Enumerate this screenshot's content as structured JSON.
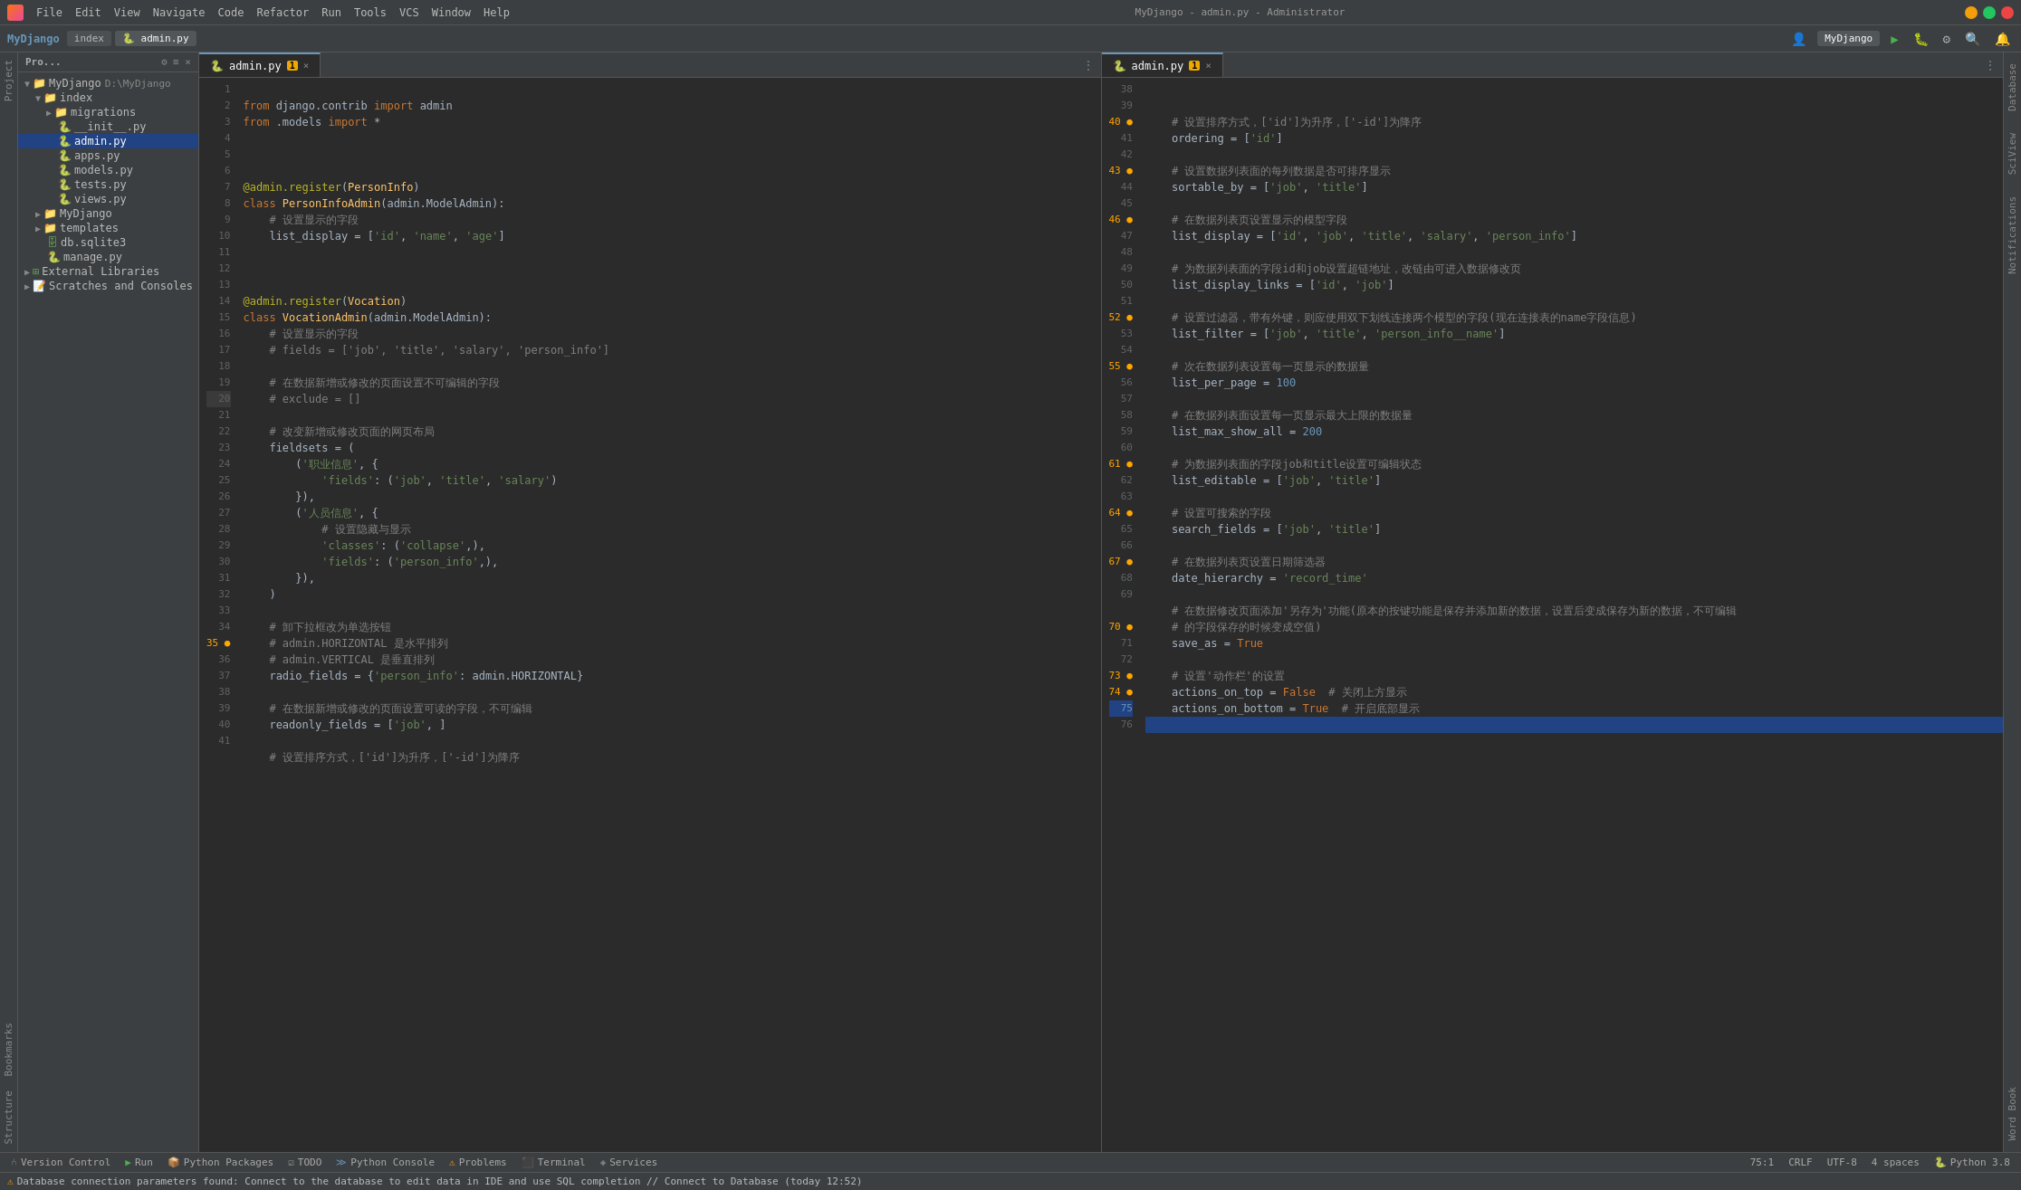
{
  "app": {
    "title": "MyDjango - admin.py - Administrator",
    "icon": "pycharm"
  },
  "menu": {
    "items": [
      "File",
      "Edit",
      "View",
      "Navigate",
      "Code",
      "Refactor",
      "Run",
      "Tools",
      "VCS",
      "Window",
      "Help"
    ]
  },
  "toolbar": {
    "project_label": "MyDjango",
    "tabs": [
      "index",
      "admin.py"
    ],
    "run_config": "MyDjango",
    "title": "MyDjango - admin.py - Administrator"
  },
  "project_panel": {
    "title": "Pro...",
    "tree": [
      {
        "id": "mydjango-root",
        "label": "MyDjango",
        "path": "D:\\MyDjango",
        "type": "root",
        "expanded": true,
        "indent": 0
      },
      {
        "id": "index",
        "label": "index",
        "type": "folder",
        "expanded": true,
        "indent": 1
      },
      {
        "id": "migrations",
        "label": "migrations",
        "type": "folder",
        "expanded": false,
        "indent": 2
      },
      {
        "id": "__init__py",
        "label": "__init__.py",
        "type": "file-py",
        "indent": 2
      },
      {
        "id": "adminpy",
        "label": "admin.py",
        "type": "file-py",
        "indent": 2,
        "selected": true
      },
      {
        "id": "appspy",
        "label": "apps.py",
        "type": "file-py",
        "indent": 2
      },
      {
        "id": "modelspy",
        "label": "models.py",
        "type": "file-py",
        "indent": 2
      },
      {
        "id": "testspy",
        "label": "tests.py",
        "type": "file-py",
        "indent": 2
      },
      {
        "id": "viewspy",
        "label": "views.py",
        "type": "file-py",
        "indent": 2
      },
      {
        "id": "mydjango",
        "label": "MyDjango",
        "type": "folder",
        "expanded": false,
        "indent": 1
      },
      {
        "id": "templates",
        "label": "templates",
        "type": "folder",
        "expanded": false,
        "indent": 1
      },
      {
        "id": "dbsqlite3",
        "label": "db.sqlite3",
        "type": "file-sqlite",
        "indent": 1
      },
      {
        "id": "managepy",
        "label": "manage.py",
        "type": "file-py",
        "indent": 1
      },
      {
        "id": "external-libs",
        "label": "External Libraries",
        "type": "folder-ext",
        "expanded": false,
        "indent": 0
      },
      {
        "id": "scratches",
        "label": "Scratches and Consoles",
        "type": "folder-scratch",
        "expanded": false,
        "indent": 0
      }
    ]
  },
  "left_editor": {
    "tab_label": "admin.py",
    "warning_count": "1",
    "lines": [
      {
        "n": 1,
        "code": "from django.contrib import admin"
      },
      {
        "n": 2,
        "code": "from .models import *"
      },
      {
        "n": 3,
        "code": ""
      },
      {
        "n": 4,
        "code": ""
      },
      {
        "n": 5,
        "code": ""
      },
      {
        "n": 6,
        "code": "@admin.register(PersonInfo)"
      },
      {
        "n": 7,
        "code": "class PersonInfoAdmin(admin.ModelAdmin):"
      },
      {
        "n": 8,
        "code": "    # 设置显示的字段"
      },
      {
        "n": 9,
        "code": "    list_display = ['id', 'name', 'age']"
      },
      {
        "n": 10,
        "code": ""
      },
      {
        "n": 11,
        "code": ""
      },
      {
        "n": 12,
        "code": ""
      },
      {
        "n": 13,
        "code": "@admin.register(Vocation)"
      },
      {
        "n": 14,
        "code": "class VocationAdmin(admin.ModelAdmin):"
      },
      {
        "n": 15,
        "code": "    # 设置显示的字段"
      },
      {
        "n": 16,
        "code": "    # fields = ['job', 'title', 'salary', 'person_info']"
      },
      {
        "n": 17,
        "code": ""
      },
      {
        "n": 18,
        "code": "    # 在数据新增或修改的页面设置不可编辑的字段"
      },
      {
        "n": 19,
        "code": "    # exclude = []"
      },
      {
        "n": 20,
        "code": ""
      },
      {
        "n": 21,
        "code": "    # 改变新增或修改页面的网页布局"
      },
      {
        "n": 22,
        "code": "    fieldsets = ("
      },
      {
        "n": 23,
        "code": "        ('职业信息', {"
      },
      {
        "n": 24,
        "code": "            'fields': ('job', 'title', 'salary')"
      },
      {
        "n": 25,
        "code": "        }),"
      },
      {
        "n": 26,
        "code": "        ('人员信息', {"
      },
      {
        "n": 27,
        "code": "            # 设置隐藏与显示"
      },
      {
        "n": 28,
        "code": "            'classes': ('collapse',),"
      },
      {
        "n": 29,
        "code": "            'fields': ('person_info',),"
      },
      {
        "n": 30,
        "code": "        }),"
      },
      {
        "n": 31,
        "code": "    )"
      },
      {
        "n": 32,
        "code": ""
      },
      {
        "n": 33,
        "code": "    # 卸下拉框改为单选按钮"
      },
      {
        "n": 34,
        "code": "    # admin.HORIZONTAL 是水平排列"
      },
      {
        "n": 35,
        "code": "    # admin.VERTICAL 是垂直排列"
      },
      {
        "n": 36,
        "code": "    radio_fields = {'person_info': admin.HORIZONTAL}"
      },
      {
        "n": 37,
        "code": ""
      },
      {
        "n": 38,
        "code": "    # 在数据新增或修改的页面设置可读的字段，不可编辑"
      },
      {
        "n": 39,
        "code": "    readonly_fields = ['job', ]"
      },
      {
        "n": 40,
        "code": ""
      },
      {
        "n": 41,
        "code": "    # 设置排序方式，['id']为升序，['-id']为降序"
      }
    ]
  },
  "right_editor": {
    "tab_label": "admin.py",
    "warning_count": "1",
    "lines": [
      {
        "n": 38,
        "code": ""
      },
      {
        "n": 39,
        "code": "    # 设置排序方式，['id']为升序，['-id']为降序"
      },
      {
        "n": 40,
        "code": "    ordering = ['id']"
      },
      {
        "n": 41,
        "code": ""
      },
      {
        "n": 42,
        "code": "    # 设置数据列表面的每列数据是否可排序显示"
      },
      {
        "n": 43,
        "code": "    sortable_by = ['job', 'title']"
      },
      {
        "n": 44,
        "code": ""
      },
      {
        "n": 45,
        "code": "    # 在数据列表页设置显示的模型字段"
      },
      {
        "n": 46,
        "code": "    list_display = ['id', 'job', 'title', 'salary', 'person_info']"
      },
      {
        "n": 47,
        "code": ""
      },
      {
        "n": 48,
        "code": "    # 为数据列表面的字段id和job设置超链地址，改链由可进入数据修改页"
      },
      {
        "n": 49,
        "code": "    list_display_links = ['id', 'job']"
      },
      {
        "n": 50,
        "code": ""
      },
      {
        "n": 51,
        "code": "    # 设置过滤器，带有外键，则应使用双下划线连接两个模型的字段(现在连接表的name字段信息)"
      },
      {
        "n": 52,
        "code": "    list_filter = ['job', 'title', 'person_info__name']"
      },
      {
        "n": 53,
        "code": ""
      },
      {
        "n": 54,
        "code": "    # 次在数据列表设置每一页显示的数据量"
      },
      {
        "n": 55,
        "code": "    list_per_page = 100"
      },
      {
        "n": 56,
        "code": ""
      },
      {
        "n": 57,
        "code": "    # 在数据列表面设置每一页显示最大上限的数据量"
      },
      {
        "n": 58,
        "code": "    list_max_show_all = 200"
      },
      {
        "n": 59,
        "code": ""
      },
      {
        "n": 60,
        "code": "    # 为数据列表面的字段job和title设置可编辑状态"
      },
      {
        "n": 61,
        "code": "    list_editable = ['job', 'title']"
      },
      {
        "n": 62,
        "code": ""
      },
      {
        "n": 63,
        "code": "    # 设置可搜索的字段"
      },
      {
        "n": 64,
        "code": "    search_fields = ['job', 'title']"
      },
      {
        "n": 65,
        "code": ""
      },
      {
        "n": 66,
        "code": "    # 在数据列表页设置日期筛选器"
      },
      {
        "n": 67,
        "code": "    date_hierarchy = 'record_time'"
      },
      {
        "n": 68,
        "code": ""
      },
      {
        "n": 69,
        "code": "    # 在数据修改页面添加'另存为'功能(原本的按键功能是保存并添加新的数据，设置后变成保存为新的数据，不可编辑"
      },
      {
        "n": 69.1,
        "code": "    # 的字段保存的时候变成空值)"
      },
      {
        "n": 70,
        "code": "    save_as = True"
      },
      {
        "n": 71,
        "code": ""
      },
      {
        "n": 72,
        "code": "    # 设置'动作栏'的设置"
      },
      {
        "n": 73,
        "code": "    actions_on_top = False  # 关闭上方显示"
      },
      {
        "n": 74,
        "code": "    actions_on_bottom = True  # 开启底部显示"
      },
      {
        "n": 75,
        "code": ""
      },
      {
        "n": 76,
        "code": ""
      }
    ]
  },
  "status_bar": {
    "version_control": "Version Control",
    "run": "Run",
    "python_packages": "Python Packages",
    "todo": "TODO",
    "python_console": "Python Console",
    "problems": "Problems",
    "terminal": "Terminal",
    "services": "Services",
    "position": "75:1",
    "line_ending": "CRLF",
    "encoding": "UTF-8",
    "indent": "4 spaces",
    "python_version": "Python 3.8"
  },
  "info_bar": {
    "message": "Database connection parameters found: Connect to the database to edit data in IDE and use SQL completion // Connect to Database (today 12:52)"
  },
  "side_panels": {
    "right": [
      "Database",
      "SciView",
      "Notifications",
      "Word Book"
    ],
    "left": [
      "Project",
      "Bookmarks",
      "Structure"
    ]
  }
}
